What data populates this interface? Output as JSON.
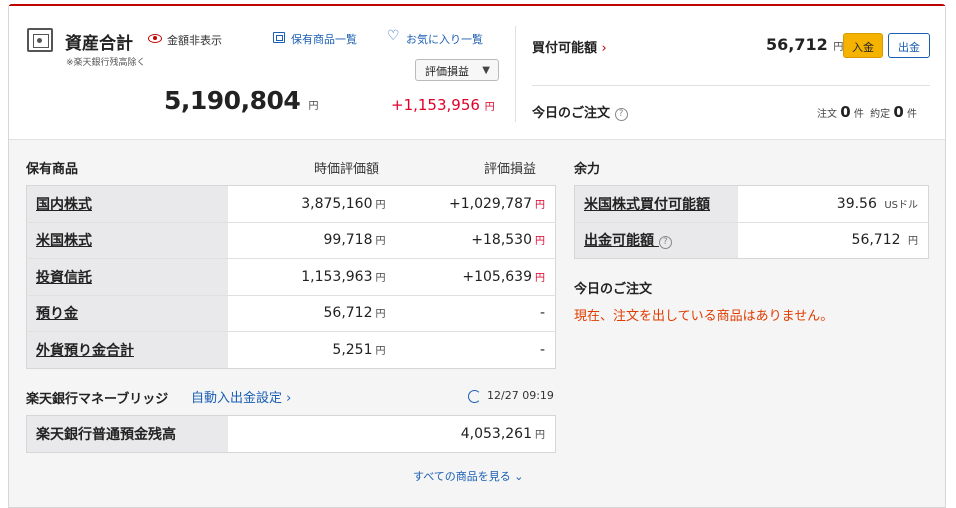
{
  "summary": {
    "title": "資産合計",
    "hide_amount": "金額非表示",
    "note": "※楽天銀行残高除く",
    "total_value": "5,190,804",
    "yen": "円",
    "holdings_link": "保有商品一覧",
    "favorites_link": "お気に入り一覧",
    "view_select": "評価損益",
    "total_gain": "+1,153,956"
  },
  "right_panel": {
    "buying_power_label": "買付可能額",
    "buying_power_value": "56,712",
    "deposit_button": "入金",
    "withdraw_button": "出金",
    "todays_orders_label": "今日のご注文",
    "orders_label": "注文",
    "orders_count": "0",
    "executed_label": "約定",
    "executed_count": "0",
    "count_unit": "件"
  },
  "holdings": {
    "header": "保有商品",
    "col_value": "時価評価額",
    "col_gain": "評価損益",
    "rows": [
      {
        "name": "国内株式",
        "value": "3,875,160",
        "gain": "+1,029,787"
      },
      {
        "name": "米国株式",
        "value": "99,718",
        "gain": "+18,530"
      },
      {
        "name": "投資信託",
        "value": "1,153,963",
        "gain": "+105,639"
      },
      {
        "name": "預り金",
        "value": "56,712",
        "gain": "-"
      },
      {
        "name": "外貨預り金合計",
        "value": "5,251",
        "gain": "-"
      }
    ]
  },
  "bridge": {
    "title": "楽天銀行マネーブリッジ",
    "auto_link": "自動入出金設定",
    "updated": "12/27 09:19",
    "balance_label": "楽天銀行普通預金残高",
    "balance_value": "4,053,261"
  },
  "capacity": {
    "header": "余力",
    "rows": [
      {
        "name": "米国株式買付可能額",
        "value": "39.56",
        "unit": "USドル"
      },
      {
        "name": "出金可能額",
        "value": "56,712",
        "unit": "円"
      }
    ]
  },
  "todays_orders": {
    "header": "今日のご注文",
    "message": "現在、注文を出している商品はありません。"
  },
  "footer": {
    "see_all": "すべての商品を見る"
  },
  "icons": [
    "safe-icon",
    "eye-icon",
    "list-icon",
    "heart-icon",
    "chevron-right-icon",
    "help-icon",
    "refresh-icon",
    "chevron-down-icon",
    "caret-down-icon"
  ],
  "colors": {
    "accent_red": "#bf0000",
    "gain_red": "#e0002a",
    "link_blue": "#1a5fb4",
    "deposit_yellow": "#f5b300",
    "notice_orange": "#e03c00"
  }
}
